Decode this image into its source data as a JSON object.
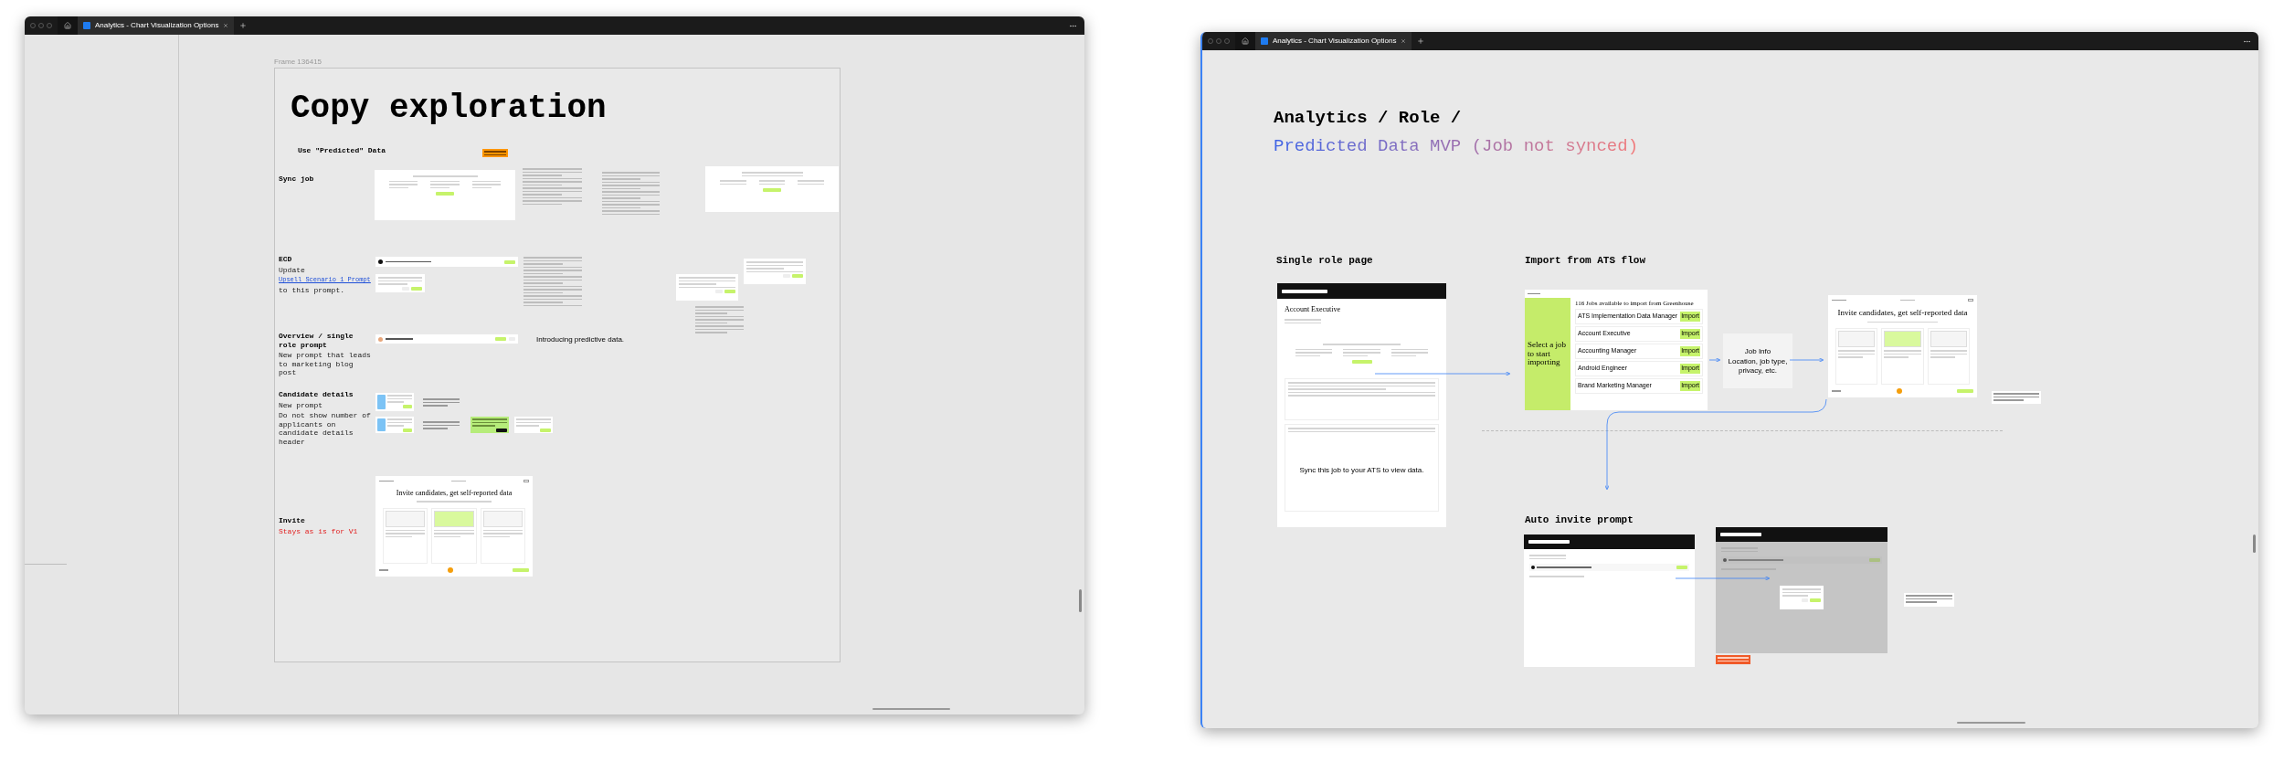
{
  "left_window": {
    "tab": {
      "title": "Analytics - Chart Visualization Options",
      "selected": true
    },
    "frame_label": "Frame 136415",
    "title": "Copy exploration",
    "subtitle": "Use \"Predicted\" Data",
    "sections": [
      {
        "label": "Sync job"
      },
      {
        "label": "ECD",
        "notes": [
          {
            "kind": "plain",
            "text": "Update"
          },
          {
            "kind": "link",
            "text": "Upsell Scenario 1 Prompt"
          },
          {
            "kind": "plain",
            "text": "to this prompt."
          }
        ]
      },
      {
        "label": "Overview / single role prompt",
        "notes": [
          {
            "kind": "plain",
            "text": "New prompt that leads to marketing blog post"
          }
        ]
      },
      {
        "label": "Candidate details",
        "notes": [
          {
            "kind": "plain",
            "text": "New prompt"
          },
          {
            "kind": "plain",
            "text": "Do not show number of applicants on candidate details header"
          }
        ]
      },
      {
        "label": "Invite",
        "notes": [
          {
            "kind": "warning",
            "text": "Stays as is for V1"
          }
        ]
      }
    ],
    "overview_text": "Introducing predictive data.",
    "invite_title": "Invite candidates, get self-reported data"
  },
  "right_window": {
    "tab": {
      "title": "Analytics - Chart Visualization Options",
      "selected": true
    },
    "heading": "Analytics / Role /",
    "subheading": "Predicted Data MVP (Job not synced)",
    "labels": [
      "Single role page",
      "Import from ATS flow",
      "Auto invite prompt"
    ],
    "role_page": {
      "title": "Account Executive",
      "empty_text": "Sync this job to your ATS to view data."
    },
    "import": {
      "side_title": "Select a job to start importing",
      "list_title": "116 Jobs available to import from Greenhouse",
      "jobs": [
        {
          "title": "ATS Implementation Data Manager",
          "button": "Import"
        },
        {
          "title": "Account Executive",
          "button": "Import"
        },
        {
          "title": "Accounting Manager",
          "button": "Import"
        },
        {
          "title": "Android Engineer",
          "button": "Import"
        },
        {
          "title": "Brand Marketing Manager",
          "button": "Import"
        }
      ]
    },
    "job_info": {
      "title": "Job Info",
      "text": "Location, job type, privacy, etc."
    },
    "invite_title": "Invite candidates, get self-reported data"
  }
}
